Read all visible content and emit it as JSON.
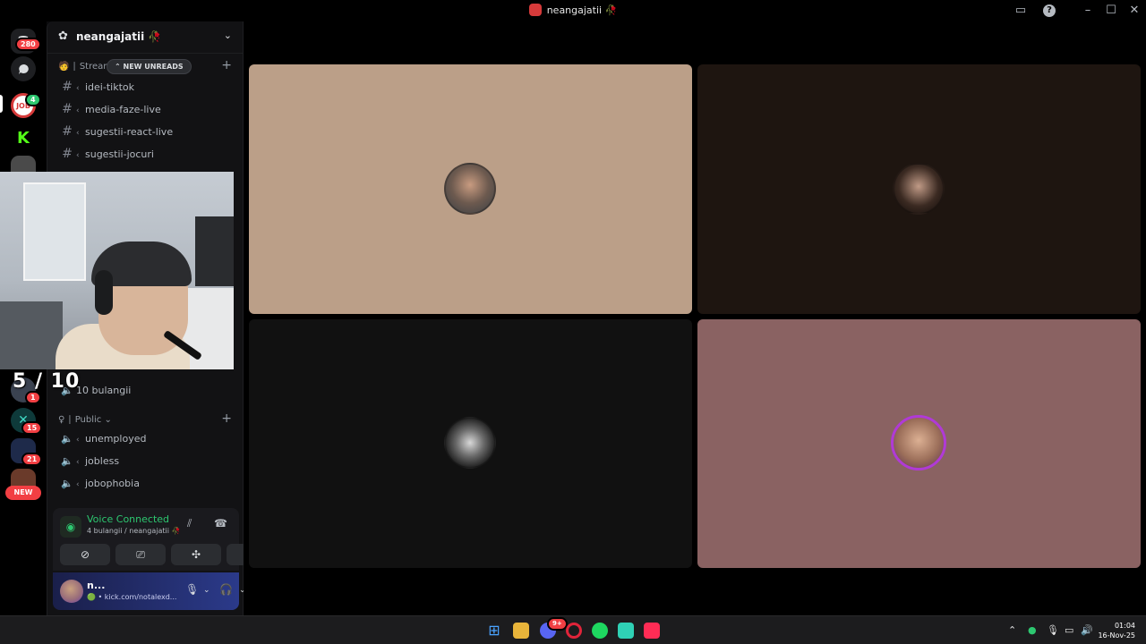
{
  "window": {
    "title": "neangajatii 🥀"
  },
  "rail": {
    "home_badge": "280",
    "job_badge": "4",
    "badge_1": "1",
    "badge_15": "15",
    "badge_21": "21",
    "new_label": "NEW"
  },
  "server": {
    "name": "neangajatii 🥀"
  },
  "sidebar": {
    "category_stream": "Stream",
    "new_unreads": "NEW UNREADS",
    "text_channels": [
      {
        "name": "idei-tiktok"
      },
      {
        "name": "media-faze-live"
      },
      {
        "name": "sugestii-react-live"
      },
      {
        "name": "sugestii-jocuri"
      }
    ],
    "overlay_score": "5 / 10",
    "voice_channel_top": "10 bulangii",
    "category_public": "Public",
    "voice_channels": [
      {
        "name": "unemployed"
      },
      {
        "name": "jobless"
      },
      {
        "name": "jobophobia"
      }
    ]
  },
  "voice_panel": {
    "status": "Voice Connected",
    "location": "4 bulangii / neangajatii 🥀"
  },
  "user_panel": {
    "name": "n...",
    "status_text": "kick.com/notalexd..."
  },
  "tiles": [
    {
      "bg": "#bb9f88"
    },
    {
      "bg": "#1e1510"
    },
    {
      "bg": "#111111"
    },
    {
      "bg": "#8a6262"
    }
  ],
  "taskbar": {
    "discord_badge": "9+",
    "time": "01:04",
    "date": "16-Nov-25"
  },
  "colors": {
    "voice_green": "#2dc770",
    "alert_red": "#f23f43",
    "user_panel_blue": "#2b3a8a"
  }
}
